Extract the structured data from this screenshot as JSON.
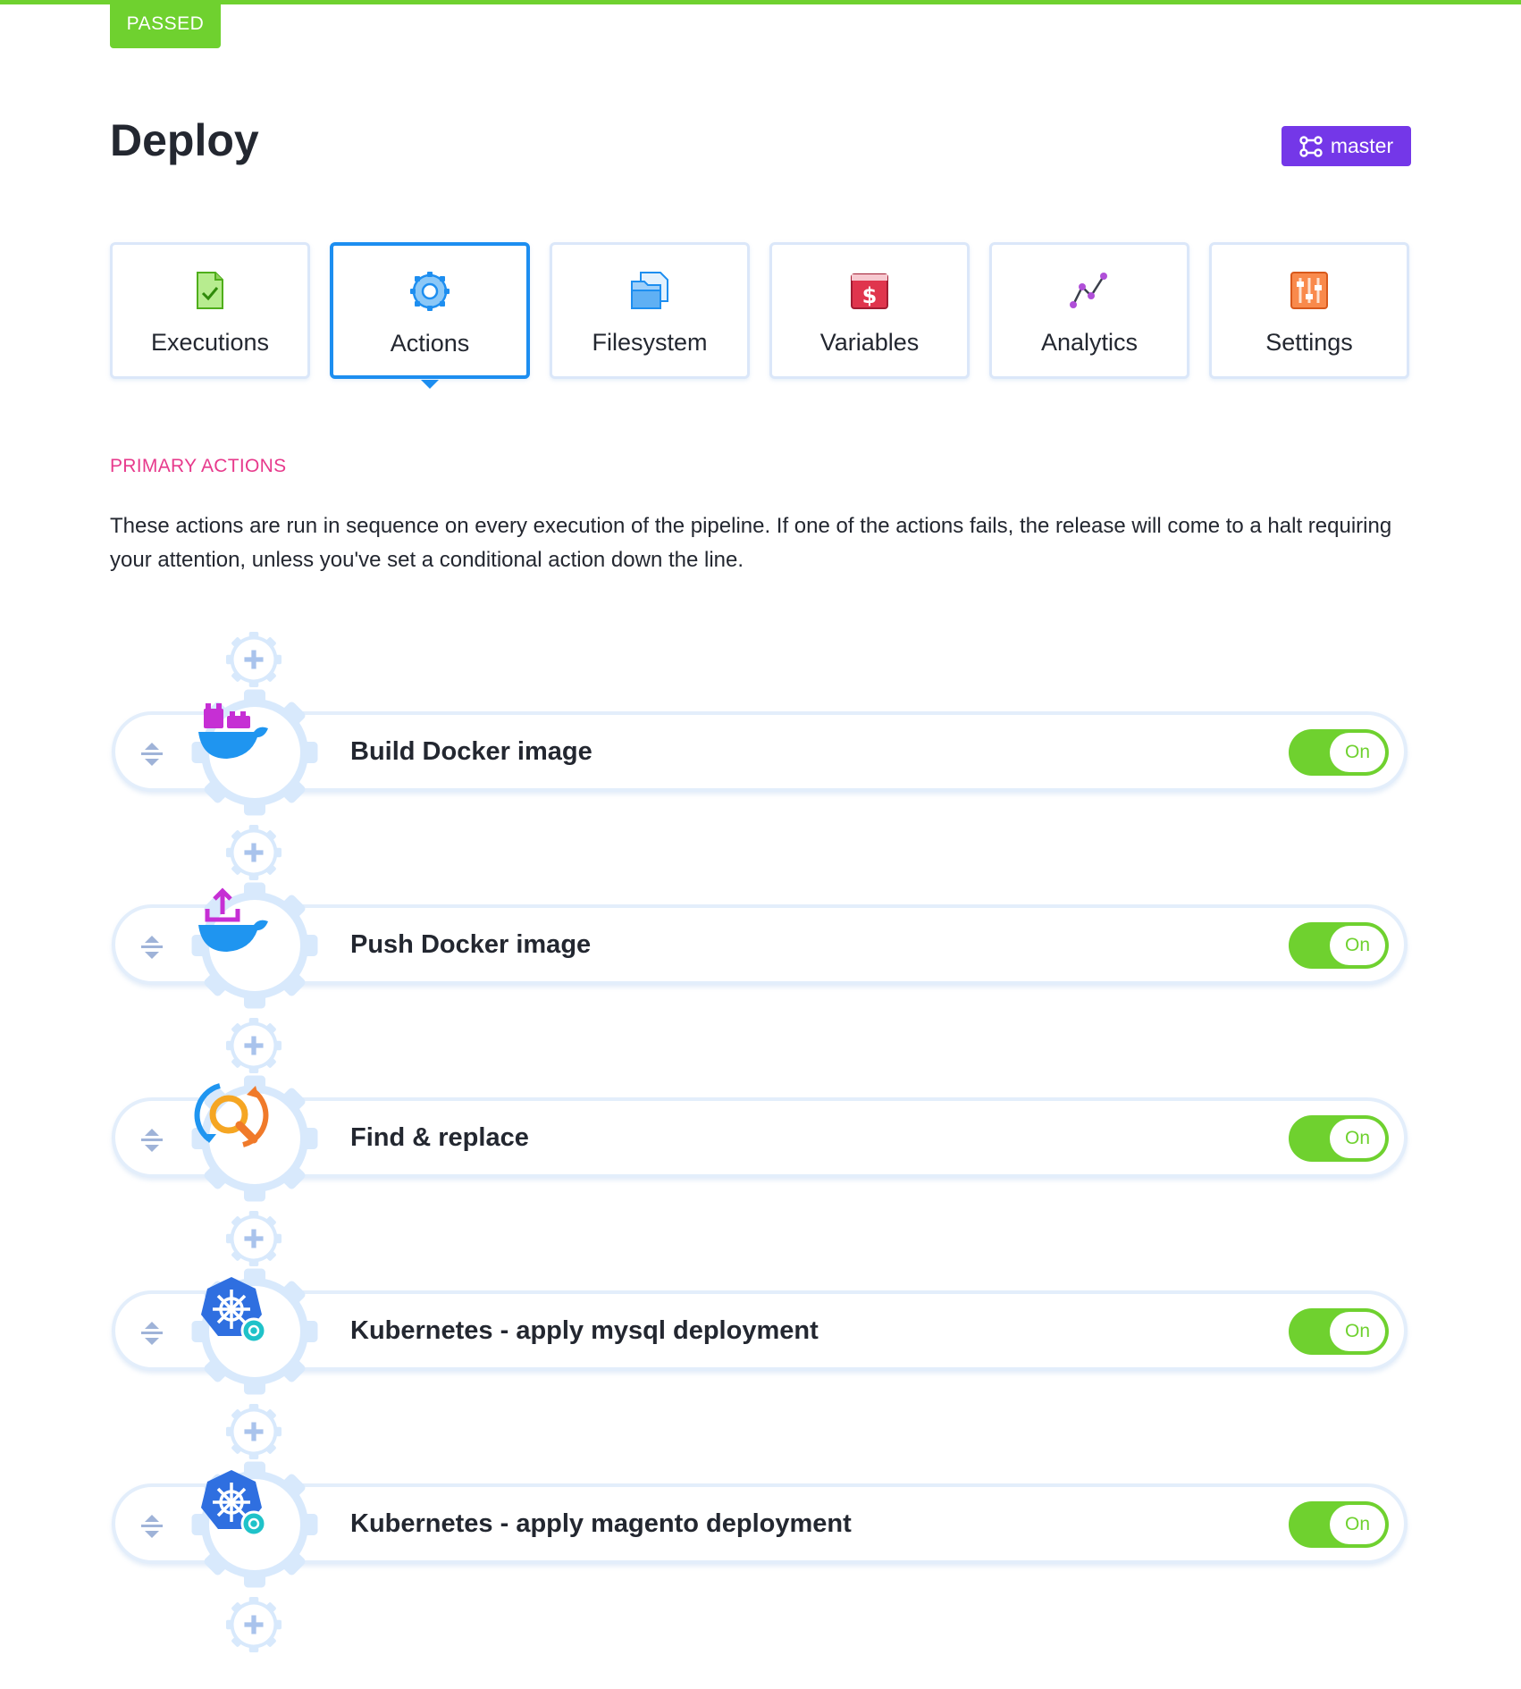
{
  "status": {
    "label": "PASSED",
    "color": "#6fd12f"
  },
  "page": {
    "title": "Deploy"
  },
  "branch": {
    "label": "master",
    "icon": "branch-icon",
    "color": "#7437e8"
  },
  "tabs": [
    {
      "label": "Executions",
      "icon": "executions-icon",
      "active": false
    },
    {
      "label": "Actions",
      "icon": "gear-icon",
      "active": true
    },
    {
      "label": "Filesystem",
      "icon": "filesystem-icon",
      "active": false
    },
    {
      "label": "Variables",
      "icon": "dollar-icon",
      "active": false
    },
    {
      "label": "Analytics",
      "icon": "analytics-icon",
      "active": false
    },
    {
      "label": "Settings",
      "icon": "sliders-icon",
      "active": false
    }
  ],
  "section": {
    "label": "PRIMARY ACTIONS",
    "description": "These actions are run in sequence on every execution of the pipeline. If one of the actions fails, the release will come to a halt requiring your attention, unless you've set a conditional action down the line."
  },
  "actions": [
    {
      "name": "Build Docker image",
      "icon": "docker-build-icon",
      "toggle": "On"
    },
    {
      "name": "Push Docker image",
      "icon": "docker-push-icon",
      "toggle": "On"
    },
    {
      "name": "Find & replace",
      "icon": "find-replace-icon",
      "toggle": "On"
    },
    {
      "name": "Kubernetes - apply mysql deployment",
      "icon": "kubernetes-icon",
      "toggle": "On"
    },
    {
      "name": "Kubernetes - apply magento deployment",
      "icon": "kubernetes-icon",
      "toggle": "On"
    }
  ],
  "colors": {
    "accent": "#1d8ef0",
    "success": "#6fd12f",
    "section": "#e73a8c"
  }
}
